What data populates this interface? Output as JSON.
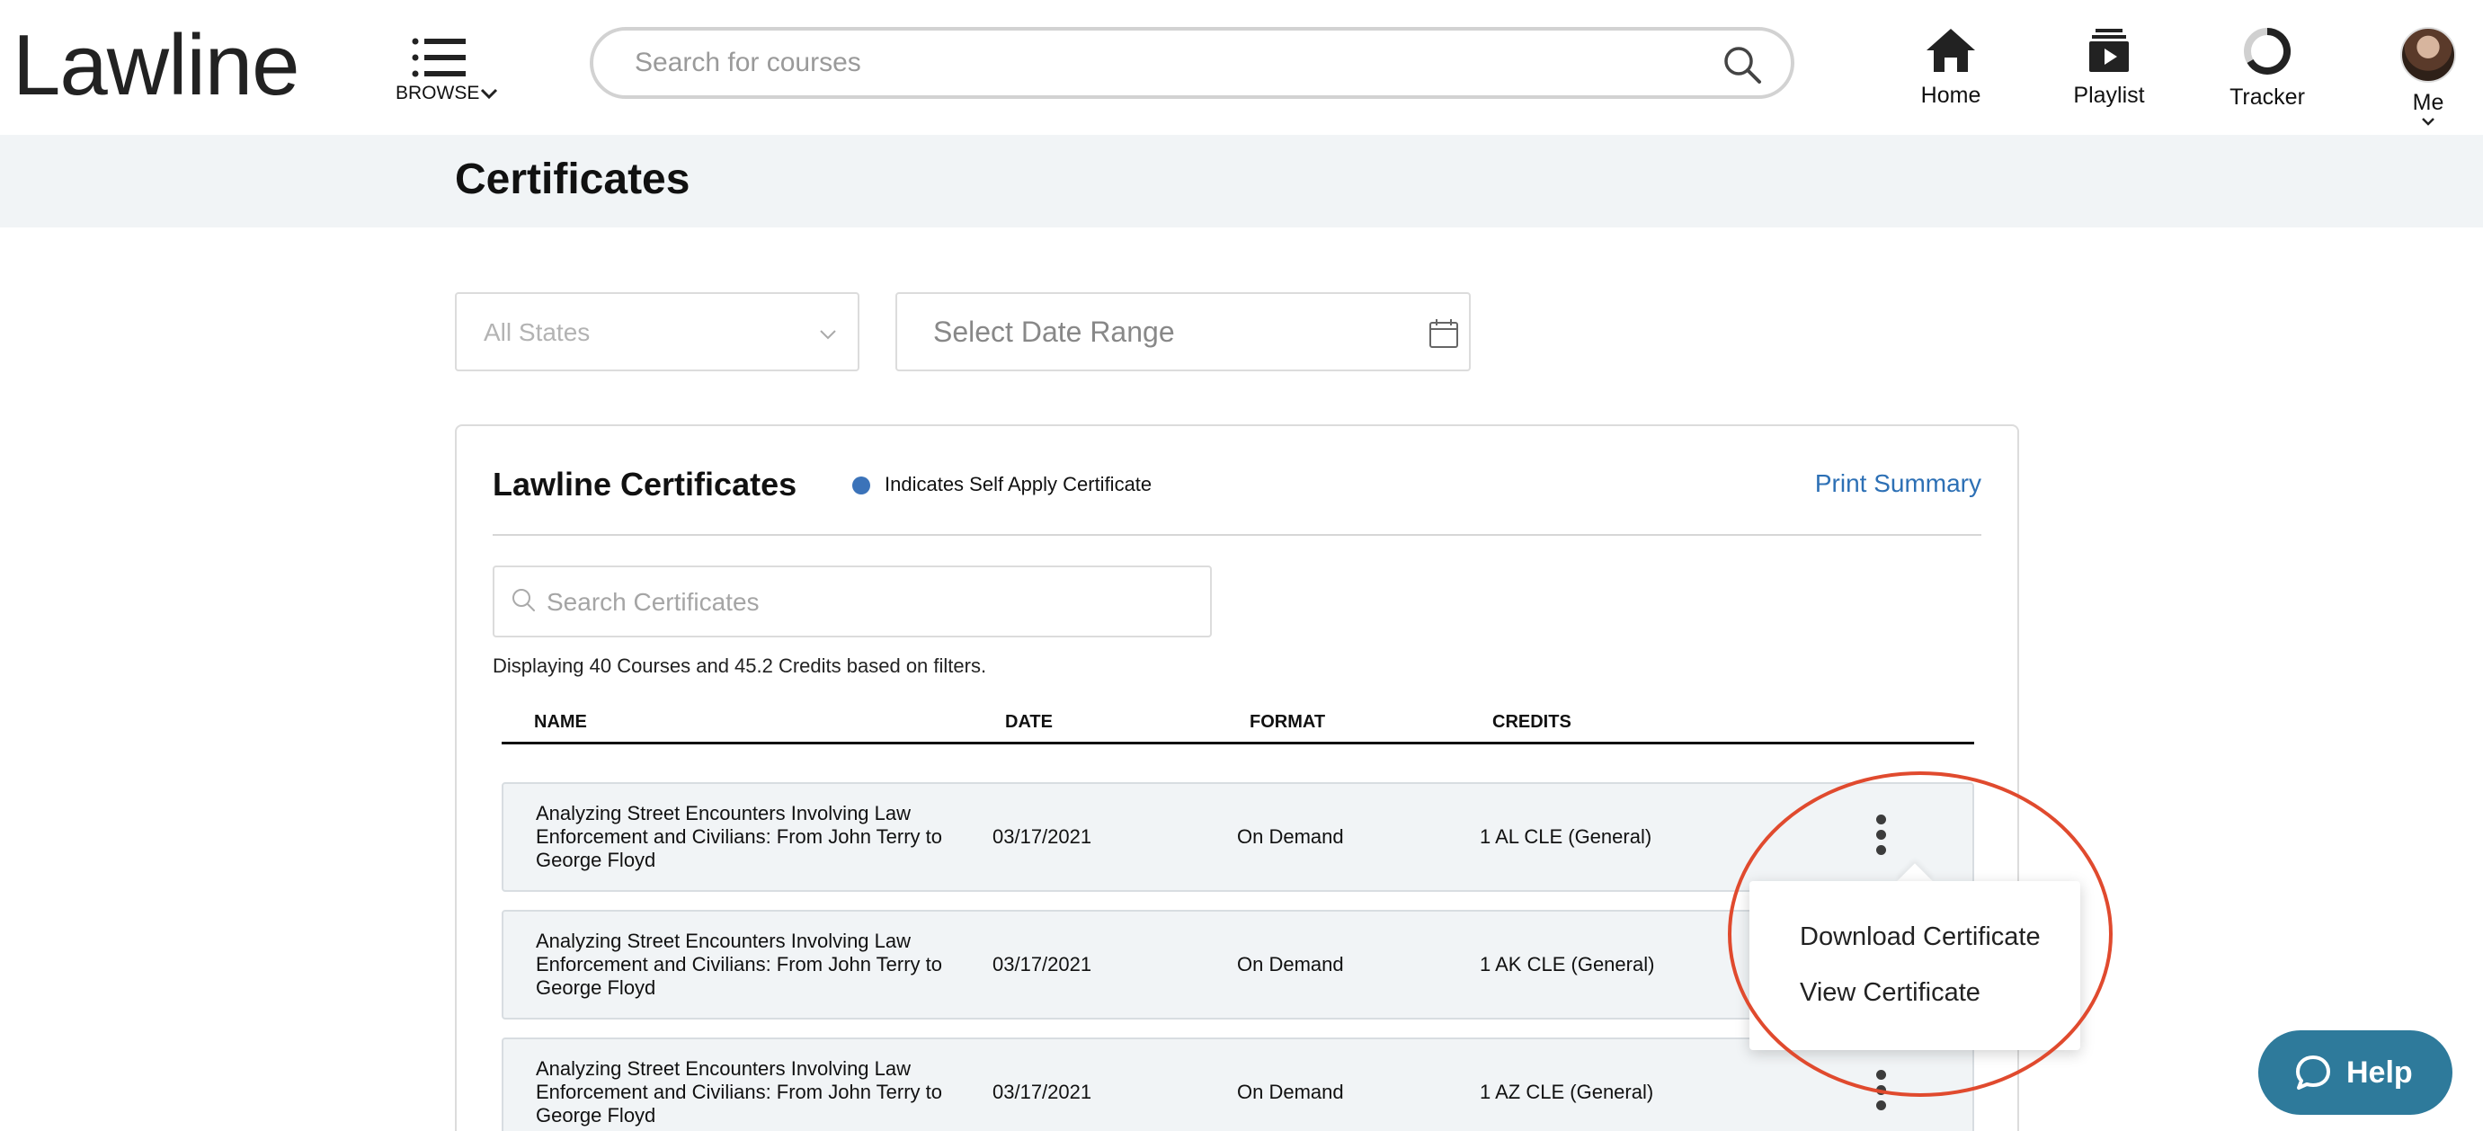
{
  "header": {
    "logo_text": "Lawline",
    "browse_label": "BROWSE",
    "search_placeholder": "Search for courses",
    "nav": {
      "home": "Home",
      "playlist": "Playlist",
      "tracker": "Tracker",
      "me": "Me"
    }
  },
  "page": {
    "title": "Certificates"
  },
  "filters": {
    "states_value": "All States",
    "date_range_placeholder": "Select Date Range"
  },
  "card": {
    "title": "Lawline Certificates",
    "legend_text": "Indicates Self Apply Certificate",
    "legend_color": "#3b73b9",
    "print_summary": "Print Summary",
    "search_placeholder": "Search Certificates",
    "display_count": "Displaying 40 Courses and 45.2 Credits based on filters."
  },
  "table": {
    "columns": [
      "NAME",
      "DATE",
      "FORMAT",
      "CREDITS"
    ],
    "rows": [
      {
        "name": "Analyzing Street Encounters Involving Law Enforcement and Civilians: From John Terry to George Floyd",
        "date": "03/17/2021",
        "format": "On Demand",
        "credits": "1 AL CLE (General)"
      },
      {
        "name": "Analyzing Street Encounters Involving Law Enforcement and Civilians: From John Terry to George Floyd",
        "date": "03/17/2021",
        "format": "On Demand",
        "credits": "1 AK CLE (General)"
      },
      {
        "name": "Analyzing Street Encounters Involving Law Enforcement and Civilians: From John Terry to George Floyd",
        "date": "03/17/2021",
        "format": "On Demand",
        "credits": "1 AZ CLE (General)"
      }
    ]
  },
  "row_menu": {
    "items": [
      "Download Certificate",
      "View Certificate"
    ]
  },
  "help": {
    "label": "Help"
  },
  "colors": {
    "accent_link": "#2d70b5",
    "annotation": "#e04a2e",
    "help_bg": "#2e7a9b",
    "band_bg": "#f1f4f6"
  }
}
